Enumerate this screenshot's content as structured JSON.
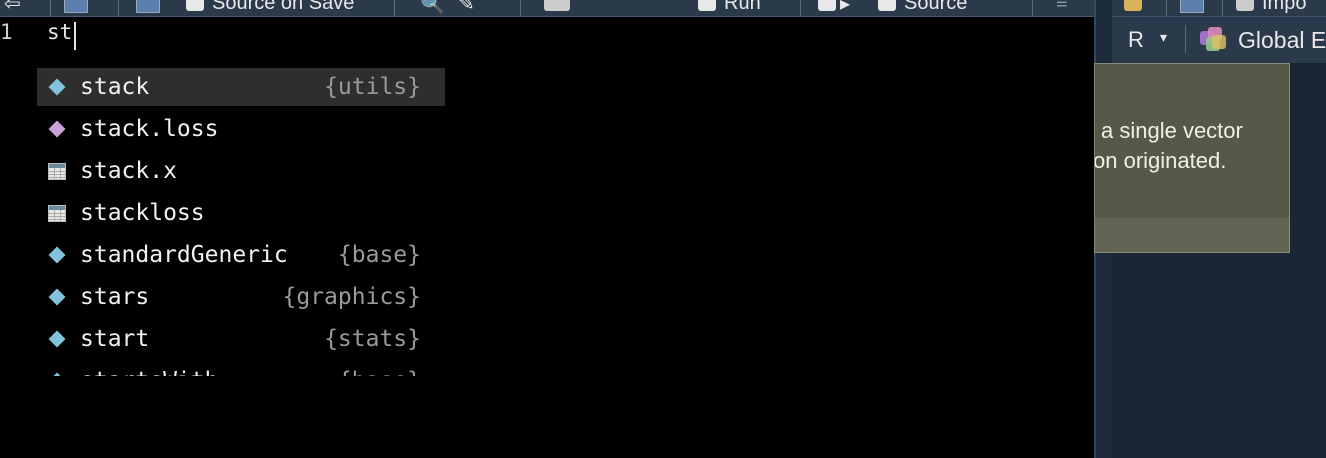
{
  "toolbar": {
    "source_on_save": "Source on Save",
    "run_label": "Run",
    "source_label": "Source"
  },
  "editor": {
    "line_number": "1",
    "code": "st"
  },
  "autocomplete": {
    "items": [
      {
        "name": "stack",
        "package": "{utils}",
        "icon": "function-diamond",
        "selected": true
      },
      {
        "name": "stack.loss",
        "package": "",
        "icon": "data-diamond"
      },
      {
        "name": "stack.x",
        "package": "",
        "icon": "table-icon"
      },
      {
        "name": "stackloss",
        "package": "",
        "icon": "table-icon"
      },
      {
        "name": "standardGeneric",
        "package": "{base}",
        "icon": "function-diamond"
      },
      {
        "name": "stars",
        "package": "{graphics}",
        "icon": "function-diamond"
      },
      {
        "name": "start",
        "package": "{stats}",
        "icon": "function-diamond"
      },
      {
        "name": "startsWith",
        "package": "{base}",
        "icon": "function-diamond"
      }
    ]
  },
  "right_pane": {
    "toolbar_label": "Impo",
    "language": "R",
    "environment": "Global E"
  },
  "tooltip": {
    "line1": "a single vector",
    "line2": "on originated."
  },
  "colors": {
    "background": "#000000",
    "function_icon": "#7fc4dc",
    "data_icon": "#c9a0d8",
    "tooltip_bg": "#585848"
  }
}
